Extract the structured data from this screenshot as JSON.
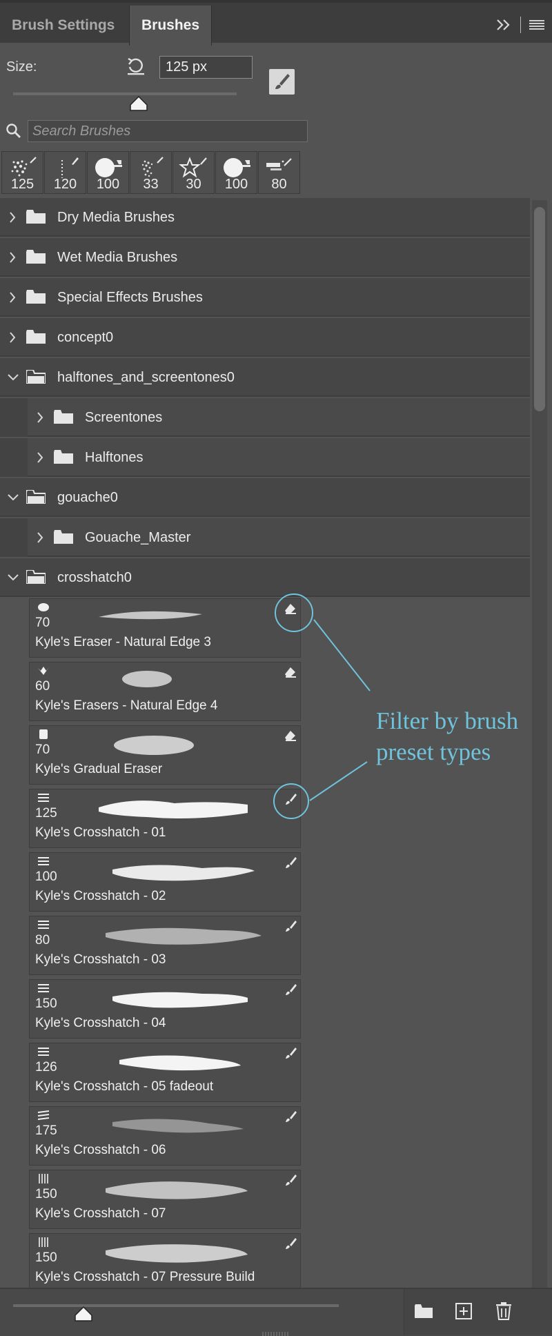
{
  "tabs": [
    {
      "label": "Brush Settings"
    },
    {
      "label": "Brushes"
    }
  ],
  "size": {
    "label": "Size:",
    "value": "125 px",
    "slider_fraction": 0.55
  },
  "search": {
    "placeholder": "Search Brushes"
  },
  "recent_brushes": [
    {
      "size": "125"
    },
    {
      "size": "120"
    },
    {
      "size": "100"
    },
    {
      "size": "33"
    },
    {
      "size": "30"
    },
    {
      "size": "100"
    },
    {
      "size": "80"
    }
  ],
  "groups": [
    {
      "label": "Dry Media Brushes",
      "expanded": false
    },
    {
      "label": "Wet Media Brushes",
      "expanded": false
    },
    {
      "label": "Special Effects Brushes",
      "expanded": false
    },
    {
      "label": "concept0",
      "expanded": false
    },
    {
      "label": "halftones_and_screentones0",
      "expanded": true
    },
    {
      "label": "Screentones",
      "expanded": false
    },
    {
      "label": "Halftones",
      "expanded": false
    },
    {
      "label": "gouache0",
      "expanded": true
    },
    {
      "label": "Gouache_Master",
      "expanded": false
    },
    {
      "label": "crosshatch0",
      "expanded": true
    }
  ],
  "brushes": [
    {
      "size": "70",
      "name": "Kyle's Eraser - Natural Edge 3",
      "type": "eraser"
    },
    {
      "size": "60",
      "name": "Kyle's Erasers - Natural Edge 4",
      "type": "eraser"
    },
    {
      "size": "70",
      "name": "Kyle's Gradual Eraser",
      "type": "eraser"
    },
    {
      "size": "125",
      "name": "Kyle's Crosshatch - 01",
      "type": "brush"
    },
    {
      "size": "100",
      "name": "Kyle's Crosshatch - 02",
      "type": "brush"
    },
    {
      "size": "80",
      "name": "Kyle's Crosshatch - 03",
      "type": "brush"
    },
    {
      "size": "150",
      "name": "Kyle's Crosshatch - 04",
      "type": "brush"
    },
    {
      "size": "126",
      "name": "Kyle's Crosshatch - 05 fadeout",
      "type": "brush"
    },
    {
      "size": "175",
      "name": "Kyle's Crosshatch - 06",
      "type": "brush"
    },
    {
      "size": "150",
      "name": "Kyle's Crosshatch - 07",
      "type": "brush"
    },
    {
      "size": "150",
      "name": "Kyle's Crosshatch - 07 Pressure Build",
      "type": "brush"
    }
  ],
  "callout": {
    "line1": "Filter by brush",
    "line2": "preset types"
  },
  "colors": {
    "panel": "#535353",
    "tabbar": "#3d3d3d",
    "accent_callout": "#6fc4dc"
  },
  "icons": [
    "expand-panel-icon",
    "panel-menu-icon",
    "reset-size-icon",
    "toggle-brush-settings-icon",
    "search-icon",
    "folder-icon",
    "chevron-right-icon",
    "chevron-down-icon",
    "eraser-type-icon",
    "brush-type-icon",
    "new-group-icon",
    "new-brush-icon",
    "trash-icon"
  ]
}
